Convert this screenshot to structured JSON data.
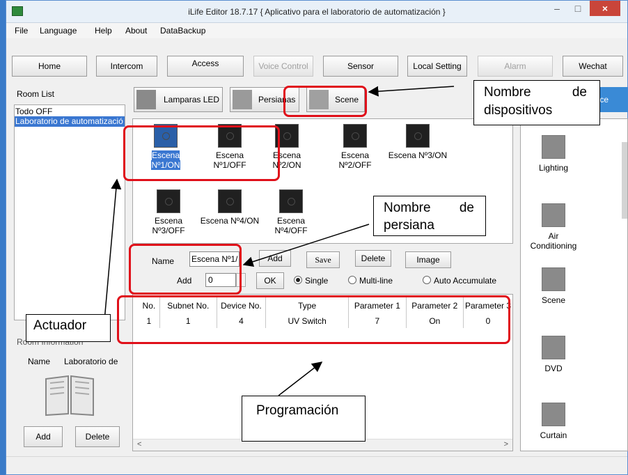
{
  "window": {
    "title": "iLife Editor 18.7.17 { Aplicativo para el laboratorio de automatización }",
    "minimize": "–",
    "maximize": "□",
    "close": "×"
  },
  "menu": [
    "File",
    "Language",
    "Help",
    "About",
    "DataBackup"
  ],
  "nav": [
    "Home",
    "Intercom",
    "Access",
    "Voice Control",
    "Sensor",
    "Local Setting",
    "Alarm",
    "Wechat"
  ],
  "room_list": {
    "title": "Room List",
    "items": [
      "Todo OFF",
      "Laboratorio de automatizació"
    ]
  },
  "room_info": {
    "title": "Room Information",
    "name_label": "Name",
    "name_value": "Laboratorio de",
    "add": "Add",
    "delete": "Delete"
  },
  "device_tabs": [
    "Lamparas LED",
    "Persianas",
    "Scene"
  ],
  "scenes": [
    "Escena Nº1/ON",
    "Escena Nº1/OFF",
    "Escena Nº2/ON",
    "Escena Nº2/OFF",
    "Escena Nº3/ON",
    "Escena Nº3/OFF",
    "Escena Nº4/ON",
    "Escena Nº4/OFF"
  ],
  "form": {
    "name_label": "Name",
    "name_value": "Escena Nº1/",
    "add_btn": "Add",
    "save_btn": "Save",
    "delete_btn": "Delete",
    "image_btn": "Image",
    "add_label": "Add",
    "add_value": "0",
    "ok_btn": "OK",
    "single": "Single",
    "multiline": "Multi-line",
    "auto": "Auto Accumulate"
  },
  "table": {
    "headers": [
      "No.",
      "Subnet No.",
      "Device No.",
      "Type",
      "Parameter 1",
      "Parameter 2",
      "Parameter 3"
    ],
    "rows": [
      [
        "1",
        "1",
        "4",
        "UV Switch",
        "7",
        "On",
        "0"
      ]
    ]
  },
  "right_panel": {
    "tab": "evice",
    "devices": [
      "Lighting",
      "Air Conditioning",
      "Scene",
      "DVD",
      "Curtain"
    ]
  },
  "annotations": {
    "nombre_dispositivos": "Nombre de dispositivos",
    "nombre_persiana": "Nombre de persiana",
    "actuador": "Actuador",
    "programacion": "Programación"
  },
  "colors": {
    "annotation_red": "#e0101a",
    "selection_blue": "#3a77d1"
  }
}
